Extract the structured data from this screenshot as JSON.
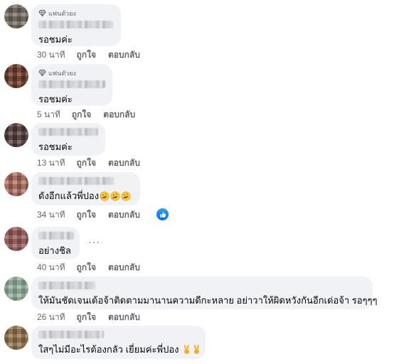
{
  "comments": [
    {
      "badge": "แฟนตัวยง",
      "text": "รอชมค่ะ",
      "time": "30 นาที",
      "like": "ถูกใจ",
      "reply": "ตอบกลับ"
    },
    {
      "badge": "แฟนตัวยง",
      "text": "รอชมค่ะ",
      "time": "5 นาที",
      "like": "ถูกใจ",
      "reply": "ตอบกลับ"
    },
    {
      "text": "รอชมค่ะ",
      "time": "13 นาที",
      "like": "ถูกใจ",
      "reply": "ตอบกลับ"
    },
    {
      "text": "ดังอีกแล้วพี่ปอง",
      "time": "34 นาที",
      "like": "ถูกใจ",
      "reply": "ตอบกลับ",
      "emoji_icons": [
        "rolling-on-floor-laughing-emoji",
        "rolling-on-floor-laughing-emoji",
        "rolling-on-floor-laughing-emoji"
      ],
      "reaction_icon": "like-reaction-icon"
    },
    {
      "text": "อย่างชิล",
      "time": "40 นาที",
      "like": "ถูกใจ",
      "reply": "ตอบกลับ",
      "more_icon": "more-options-icon"
    },
    {
      "text": "ให้มันชัดเจนเด้อจ้าติดตามมานานความดีกะหลาย อย่าวาให้ผิดหวังกันอีกเด่อจ้า รอๆๆๆ",
      "time": "26 นาที",
      "like": "ถูกใจ",
      "reply": "ตอบกลับ"
    },
    {
      "text": "ใสๆไม่มีอะไรต้องกลัว เยี่ยมค่ะพี่ปอง",
      "emoji_icons": [
        "victory-hand-emoji",
        "victory-hand-emoji"
      ]
    }
  ],
  "colors": {
    "bubble": "#f0f2f5",
    "secondary_text": "#65676b",
    "like_blue": "#0866ff"
  }
}
